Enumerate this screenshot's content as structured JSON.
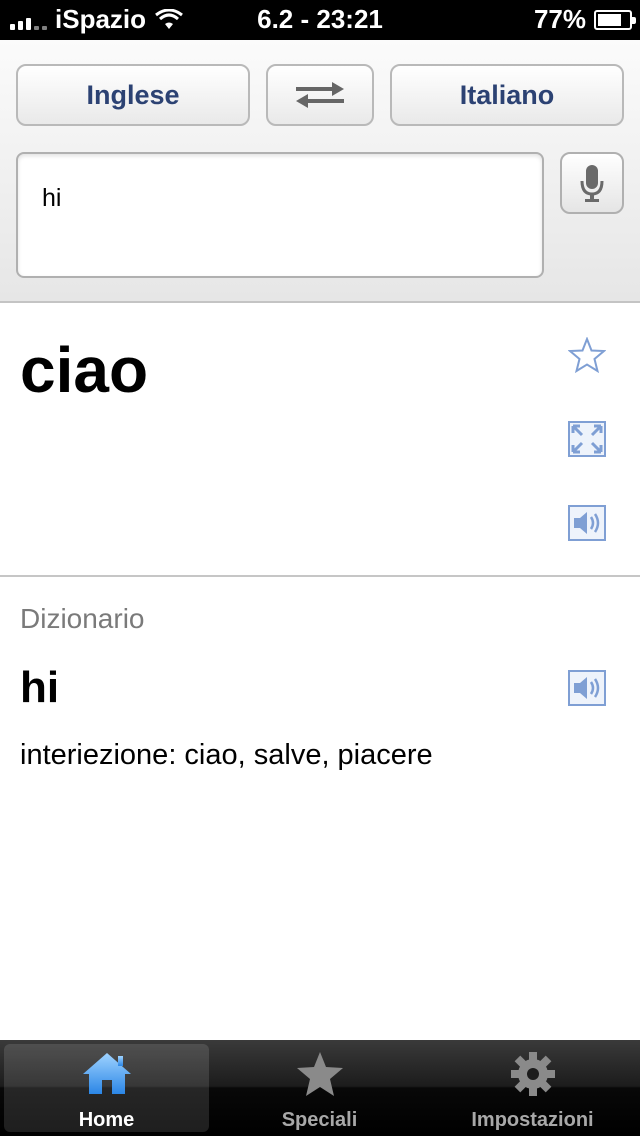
{
  "status_bar": {
    "carrier": "iSpazio",
    "time": "6.2 - 23:21",
    "battery": "77%",
    "battery_level": 0.77
  },
  "language_bar": {
    "source_language": "Inglese",
    "target_language": "Italiano",
    "swap_icon": "swap-arrows-icon"
  },
  "input": {
    "value": "hi",
    "mic_icon": "microphone-icon"
  },
  "translation": {
    "text": "ciao",
    "icons": [
      "star-icon",
      "fullscreen-icon",
      "speaker-icon"
    ]
  },
  "dictionary": {
    "label": "Dizionario",
    "word": "hi",
    "definition": "interiezione: ciao, salve, piacere"
  },
  "tabs": [
    {
      "label": "Home",
      "icon": "home-icon",
      "active": true
    },
    {
      "label": "Speciali",
      "icon": "star-icon",
      "active": false
    },
    {
      "label": "Impostazioni",
      "icon": "gear-icon",
      "active": false
    }
  ],
  "colors": {
    "accent": "#2c4273",
    "icon_blue": "#7f9fd4",
    "tab_active": "#4aa3ff"
  }
}
